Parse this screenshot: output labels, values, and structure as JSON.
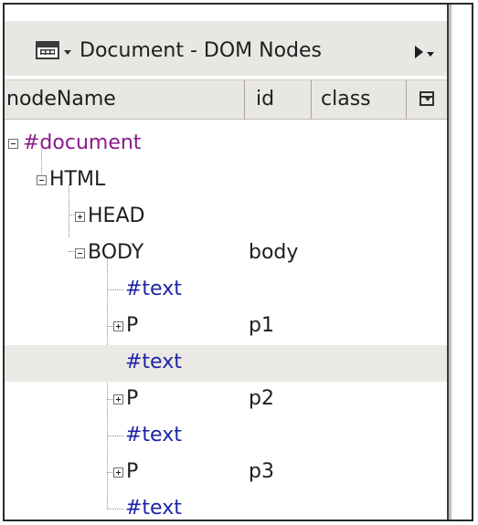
{
  "panel": {
    "menu_icon": "grid-icon",
    "title": "Document - DOM Nodes",
    "more_icon": "play-menu-icon"
  },
  "columns": {
    "nodeName": "nodeName",
    "id": "id",
    "class": "class",
    "picker_icon": "column-picker-icon"
  },
  "tree": {
    "rows": [
      {
        "name": "#document",
        "id": "",
        "toggle": "minus"
      },
      {
        "name": "HTML",
        "id": "",
        "toggle": "minus"
      },
      {
        "name": "HEAD",
        "id": "",
        "toggle": "plus"
      },
      {
        "name": "BODY",
        "id": "body",
        "toggle": "minus"
      },
      {
        "name": "#text",
        "id": "",
        "toggle": ""
      },
      {
        "name": "P",
        "id": "p1",
        "toggle": "plus"
      },
      {
        "name": "#text",
        "id": "",
        "toggle": "",
        "selected": true
      },
      {
        "name": "P",
        "id": "p2",
        "toggle": "plus"
      },
      {
        "name": "#text",
        "id": "",
        "toggle": ""
      },
      {
        "name": "P",
        "id": "p3",
        "toggle": "plus"
      },
      {
        "name": "#text",
        "id": "",
        "toggle": ""
      }
    ]
  },
  "colors": {
    "document_node": "#8a1a8a",
    "element_node": "#1e1e1e",
    "text_node": "#1e24a6",
    "selected_row": "#ebe9e5"
  }
}
